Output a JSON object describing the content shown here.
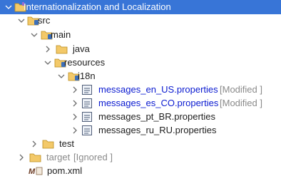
{
  "tree": {
    "project": {
      "label": "Internationalization and Localization"
    },
    "src": {
      "label": "src"
    },
    "main": {
      "label": "main"
    },
    "java": {
      "label": "java"
    },
    "resources": {
      "label": "resources"
    },
    "i18n": {
      "label": "i18n"
    },
    "files": [
      {
        "label": "messages_en_US.properties",
        "decoration": "[Modified ]"
      },
      {
        "label": "messages_es_CO.properties",
        "decoration": "[Modified ]"
      },
      {
        "label": "messages_pt_BR.properties",
        "decoration": ""
      },
      {
        "label": "messages_ru_RU.properties",
        "decoration": ""
      }
    ],
    "test": {
      "label": "test"
    },
    "target": {
      "label": "target",
      "decoration": "[Ignored ]"
    },
    "pom": {
      "label": "pom.xml"
    }
  },
  "colors": {
    "selection": "#3875d7",
    "modified_text": "#0a1ad0",
    "decoration_text": "#8a8a8a",
    "folder": "#e8b94a"
  }
}
